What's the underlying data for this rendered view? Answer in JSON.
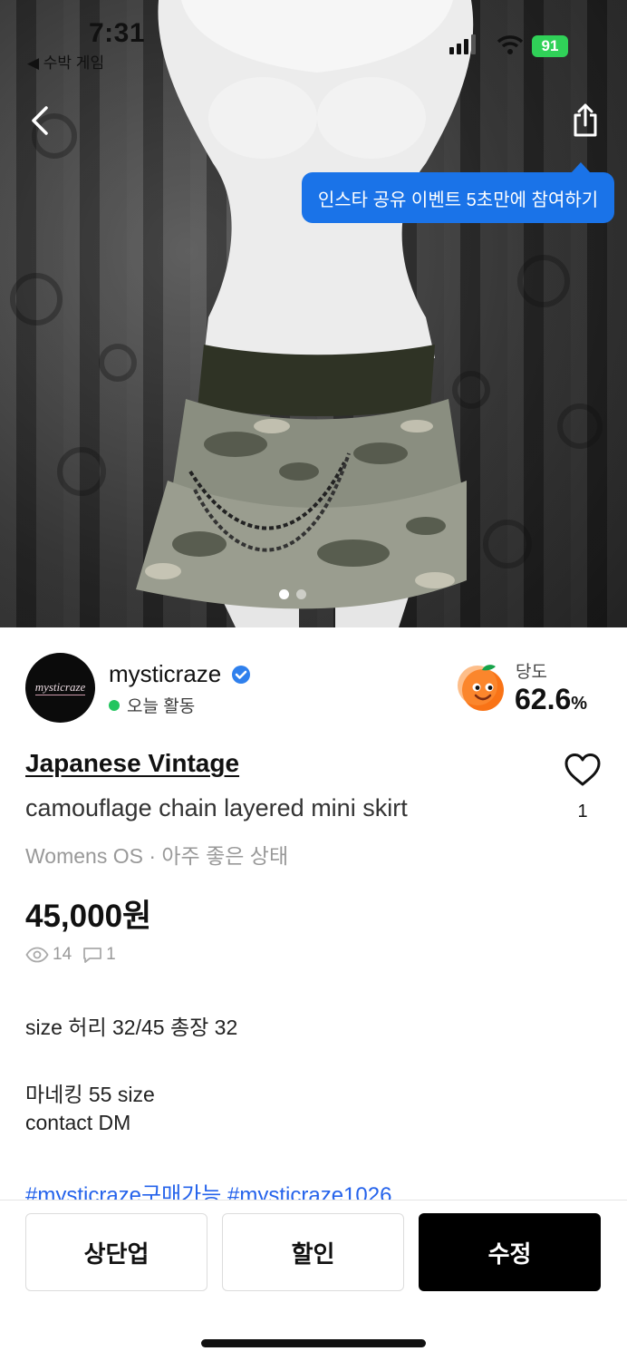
{
  "status_bar": {
    "time": "7:31",
    "carrier_label": "◀ 수박 게임",
    "battery": "91"
  },
  "photo": {
    "tooltip": "인스타 공유 이벤트 5초만에 참여하기",
    "slide_count": 2,
    "active_slide": 1
  },
  "seller": {
    "avatar_text": "mysticraze",
    "name": "mysticraze",
    "activity": "오늘 활동",
    "sweetness_label": "당도",
    "sweetness_value": "62.6",
    "sweetness_unit": "%"
  },
  "product": {
    "brand": "Japanese Vintage",
    "title": "camouflage chain layered mini skirt",
    "meta": "Womens OS · 아주 좋은 상태",
    "price": "45,000원",
    "likes": "1",
    "views": "14",
    "comments": "1",
    "description": [
      "size 허리 32/45 총장 32",
      "마네킹 55 size",
      "contact DM"
    ],
    "hashtags": "#mysticraze구매가능 #mysticraze1026"
  },
  "actions": {
    "bump_label": "상단업",
    "discount_label": "할인",
    "edit_label": "수정"
  },
  "icons": {
    "back": "back-arrow-icon",
    "share": "share-icon",
    "like": "heart-icon",
    "views": "eye-icon",
    "comments": "comment-icon",
    "verified": "verified-badge-icon",
    "sweetness": "peach-mascot-icon"
  },
  "colors": {
    "tooltip_bg": "#1a73e8",
    "hashtag": "#2563eb",
    "active_green": "#22c55e",
    "battery_green": "#30d158",
    "primary_button": "#000000"
  }
}
